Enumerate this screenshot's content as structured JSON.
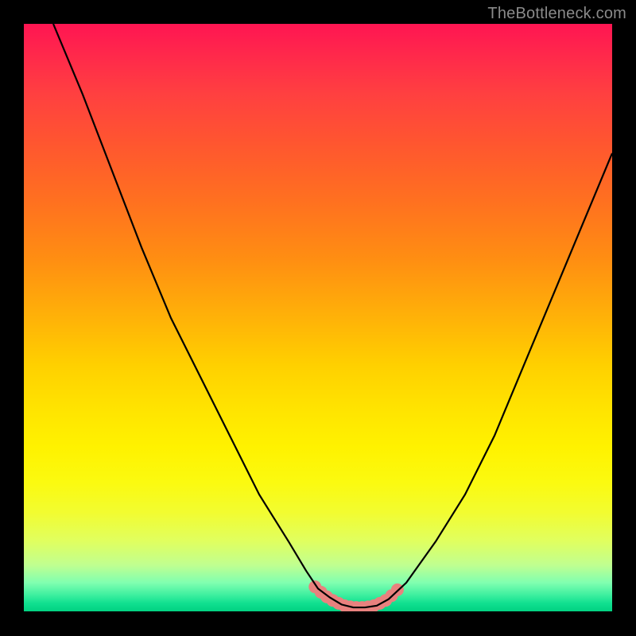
{
  "watermark": "TheBottleneck.com",
  "chart_data": {
    "type": "line",
    "title": "",
    "xlabel": "",
    "ylabel": "",
    "xlim": [
      0,
      100
    ],
    "ylim": [
      0,
      100
    ],
    "grid": false,
    "curve": {
      "name": "bottleneck-curve",
      "color": "#000000",
      "points": [
        {
          "x": 5,
          "y": 100
        },
        {
          "x": 10,
          "y": 88
        },
        {
          "x": 15,
          "y": 75
        },
        {
          "x": 20,
          "y": 62
        },
        {
          "x": 25,
          "y": 50
        },
        {
          "x": 30,
          "y": 40
        },
        {
          "x": 35,
          "y": 30
        },
        {
          "x": 40,
          "y": 20
        },
        {
          "x": 45,
          "y": 12
        },
        {
          "x": 48,
          "y": 7
        },
        {
          "x": 50,
          "y": 4
        },
        {
          "x": 52,
          "y": 2.5
        },
        {
          "x": 54,
          "y": 1.3
        },
        {
          "x": 56,
          "y": 0.8
        },
        {
          "x": 58,
          "y": 0.8
        },
        {
          "x": 60,
          "y": 1.1
        },
        {
          "x": 62,
          "y": 2.2
        },
        {
          "x": 65,
          "y": 5
        },
        {
          "x": 70,
          "y": 12
        },
        {
          "x": 75,
          "y": 20
        },
        {
          "x": 80,
          "y": 30
        },
        {
          "x": 85,
          "y": 42
        },
        {
          "x": 90,
          "y": 54
        },
        {
          "x": 95,
          "y": 66
        },
        {
          "x": 100,
          "y": 78
        }
      ]
    },
    "highlight": {
      "name": "optimal-range",
      "color": "#e8817e",
      "points": [
        {
          "x": 49.5,
          "y": 4.3
        },
        {
          "x": 50.5,
          "y": 3.4
        },
        {
          "x": 51.5,
          "y": 2.6
        },
        {
          "x": 52.5,
          "y": 2.0
        },
        {
          "x": 53.5,
          "y": 1.5
        },
        {
          "x": 54.5,
          "y": 1.1
        },
        {
          "x": 55.5,
          "y": 0.9
        },
        {
          "x": 56.5,
          "y": 0.8
        },
        {
          "x": 57.5,
          "y": 0.8
        },
        {
          "x": 58.5,
          "y": 0.9
        },
        {
          "x": 59.5,
          "y": 1.1
        },
        {
          "x": 60.5,
          "y": 1.5
        },
        {
          "x": 61.5,
          "y": 2.0
        },
        {
          "x": 62.5,
          "y": 2.8
        },
        {
          "x": 63.5,
          "y": 3.8
        }
      ]
    }
  }
}
